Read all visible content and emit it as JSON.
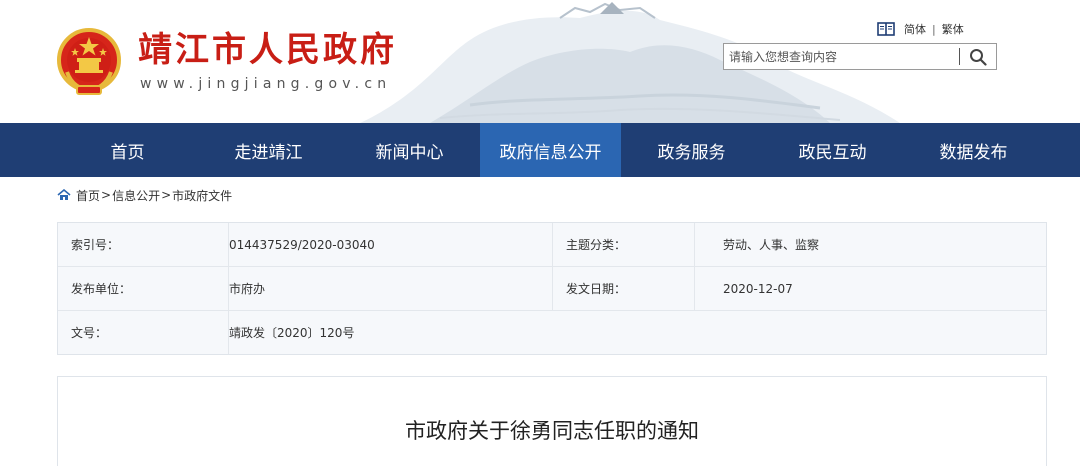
{
  "header": {
    "site_title": "靖江市人民政府",
    "site_url": "www.jingjiang.gov.cn",
    "lang_simplified": "简体",
    "lang_separator": "|",
    "lang_traditional": "繁体",
    "search_placeholder": "请输入您想查询内容",
    "emblem_icon": "national-emblem-icon",
    "colors": {
      "title": "#c81e15"
    }
  },
  "nav": {
    "items": [
      {
        "label": "首页"
      },
      {
        "label": "走进靖江"
      },
      {
        "label": "新闻中心"
      },
      {
        "label": "政府信息公开",
        "active": true
      },
      {
        "label": "政务服务"
      },
      {
        "label": "政民互动"
      },
      {
        "label": "数据发布"
      }
    ],
    "colors": {
      "background": "#1f3e74",
      "active": "#2b66b2"
    }
  },
  "breadcrumb": {
    "items": [
      "首页",
      "信息公开",
      "市政府文件"
    ],
    "separator": ">"
  },
  "meta": {
    "index_label": "索引号：",
    "index_value": "014437529/2020-03040",
    "topic_label": "主题分类：",
    "topic_value": "劳动、人事、监察",
    "publisher_label": "发布单位：",
    "publisher_value": "市府办",
    "date_label": "发文日期：",
    "date_value": "2020-12-07",
    "doc_no_label": "文号：",
    "doc_no_value": "靖政发〔2020〕120号"
  },
  "article": {
    "title": "市政府关于徐勇同志任职的通知"
  }
}
